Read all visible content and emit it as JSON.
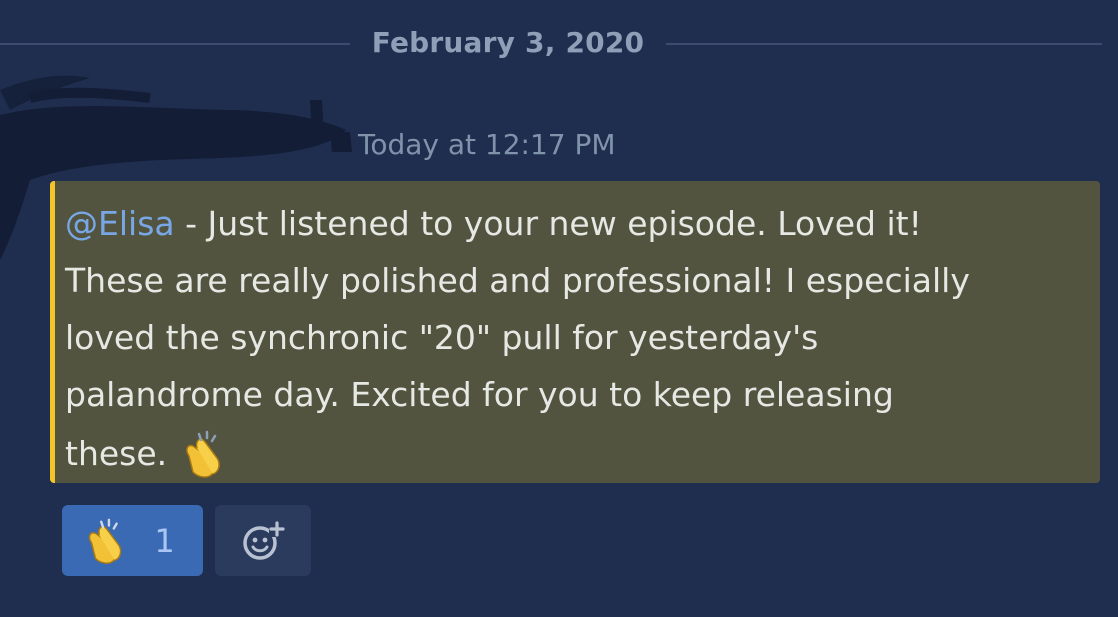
{
  "divider": {
    "date": "February 3, 2020"
  },
  "message": {
    "timestamp": "Today at 12:17 PM",
    "mention": "@Elisa",
    "lines": [
      " - Just listened to your new episode. Loved it!",
      "These are really polished and professional! I especially",
      "loved the synchronic \"20\" pull for yesterday's",
      "palandrome day. Excited for you to keep releasing",
      "these."
    ],
    "inline_emoji": "clapping-hands-emoji"
  },
  "reactions": [
    {
      "emoji": "clapping-hands-emoji",
      "count": "1"
    }
  ],
  "add_reaction": {
    "icon": "add-reaction-icon"
  },
  "colors": {
    "background": "#1f2d4f",
    "highlight": "#52543f",
    "highlight_bar": "#f2c52a",
    "mention": "#79a7e6",
    "reaction_active": "#3a6ab3"
  }
}
